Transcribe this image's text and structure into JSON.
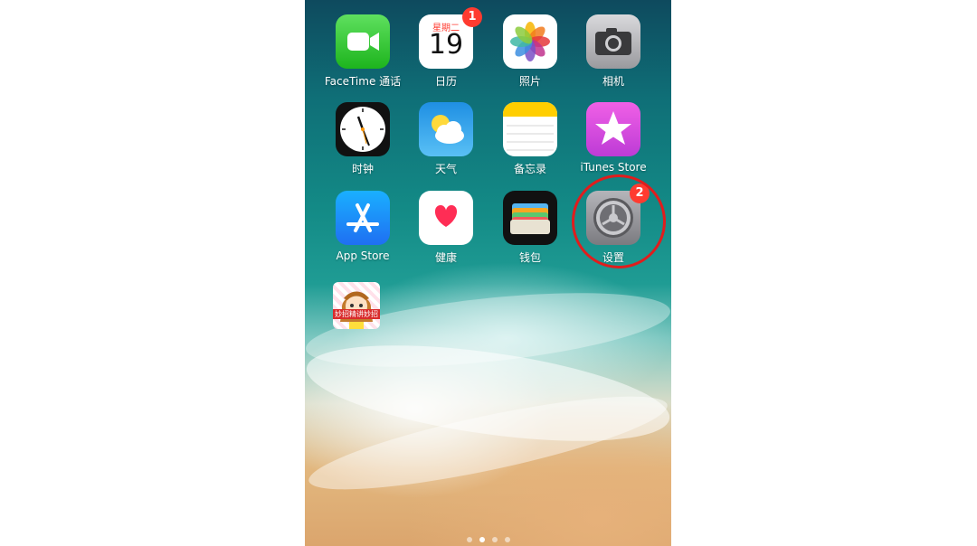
{
  "home": {
    "apps": [
      {
        "label": "FaceTime 通话",
        "icon": "facetime-icon"
      },
      {
        "label": "日历",
        "icon": "calendar-icon",
        "badge": "1",
        "weekday": "星期二",
        "day": "19"
      },
      {
        "label": "照片",
        "icon": "photos-icon"
      },
      {
        "label": "相机",
        "icon": "camera-icon"
      },
      {
        "label": "时钟",
        "icon": "clock-icon"
      },
      {
        "label": "天气",
        "icon": "weather-icon"
      },
      {
        "label": "备忘录",
        "icon": "notes-icon"
      },
      {
        "label": "iTunes Store",
        "icon": "itunes-store-icon"
      },
      {
        "label": "App Store",
        "icon": "app-store-icon"
      },
      {
        "label": "健康",
        "icon": "health-icon"
      },
      {
        "label": "钱包",
        "icon": "wallet-icon"
      },
      {
        "label": "设置",
        "icon": "settings-icon",
        "badge": "2"
      },
      {
        "label": "",
        "icon": "custom-app-icon",
        "icon_text": "妙招精讲妙招"
      }
    ],
    "page_dots": 4,
    "active_page": 2,
    "highlight_color": "#e01d1d"
  }
}
